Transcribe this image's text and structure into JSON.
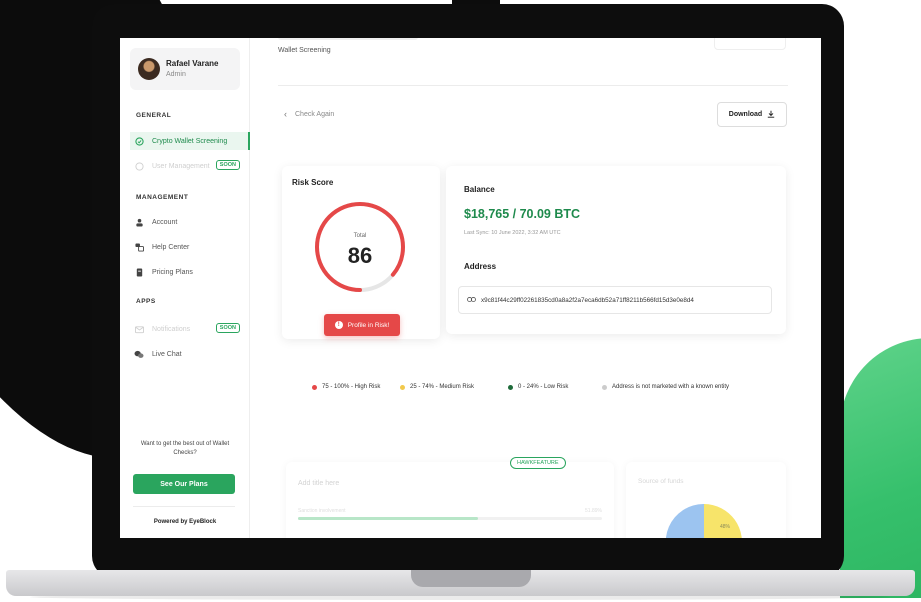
{
  "user": {
    "name": "Rafael Varane",
    "role": "Admin"
  },
  "sidebar": {
    "general_heading": "GENERAL",
    "general_items": [
      {
        "label": "Crypto Wallet Screening",
        "icon": "shield-icon",
        "active": true
      },
      {
        "label": "User Management",
        "icon": "users-icon",
        "badge": "SOON",
        "disabled": true
      }
    ],
    "management_heading": "MANAGEMENT",
    "management_items": [
      {
        "label": "Account",
        "icon": "person-icon"
      },
      {
        "label": "Help Center",
        "icon": "help-icon"
      },
      {
        "label": "Pricing Plans",
        "icon": "pricing-icon"
      }
    ],
    "apps_heading": "APPS",
    "apps_items": [
      {
        "label": "Notifications",
        "icon": "mail-icon",
        "badge": "SOON",
        "disabled": true
      },
      {
        "label": "Live Chat",
        "icon": "chat-icon"
      }
    ],
    "promo_text": "Want to get the best out of Wallet Checks?",
    "plans_button": "See Our Plans",
    "powered_by": "Powered by EyeBlock"
  },
  "header": {
    "subtitle": "Wallet Screening",
    "back_label": "Check Again",
    "download_label": "Download"
  },
  "risk": {
    "title": "Risk Score",
    "total_label": "Total",
    "score": "86",
    "score_value": 86,
    "status_label": "Profile in Risk!",
    "color": "#e54848"
  },
  "balance": {
    "title": "Balance",
    "value": "$18,765 / 70.09 BTC",
    "last_sync": "Last Sync: 10 June 2022, 3:32 AM UTC",
    "address_title": "Address",
    "address": "x9c81f44c29ff02261835cd0a8a2f2a7eca6db52a71ff8211b566fd15d3e0e8d4"
  },
  "legend": [
    {
      "label": "75 - 100% - High Risk",
      "color": "#e54848"
    },
    {
      "label": "25 - 74% - Medium Risk",
      "color": "#f2c94c"
    },
    {
      "label": "0 - 24% - Low Risk",
      "color": "#1e6b3a"
    },
    {
      "label": "Address is not marketed with a known entity",
      "color": "#cccccc"
    }
  ],
  "lower": {
    "card1_title": "Add title here",
    "card1_sub": "Sanction involvement",
    "card1_pct": "51.89%",
    "badge": "HAWKFEATURE",
    "card2_title": "Source of funds",
    "pie_label": "48%"
  },
  "colors": {
    "accent": "#2aa55e",
    "accent_dark": "#1e8a4c",
    "danger": "#e54848"
  }
}
